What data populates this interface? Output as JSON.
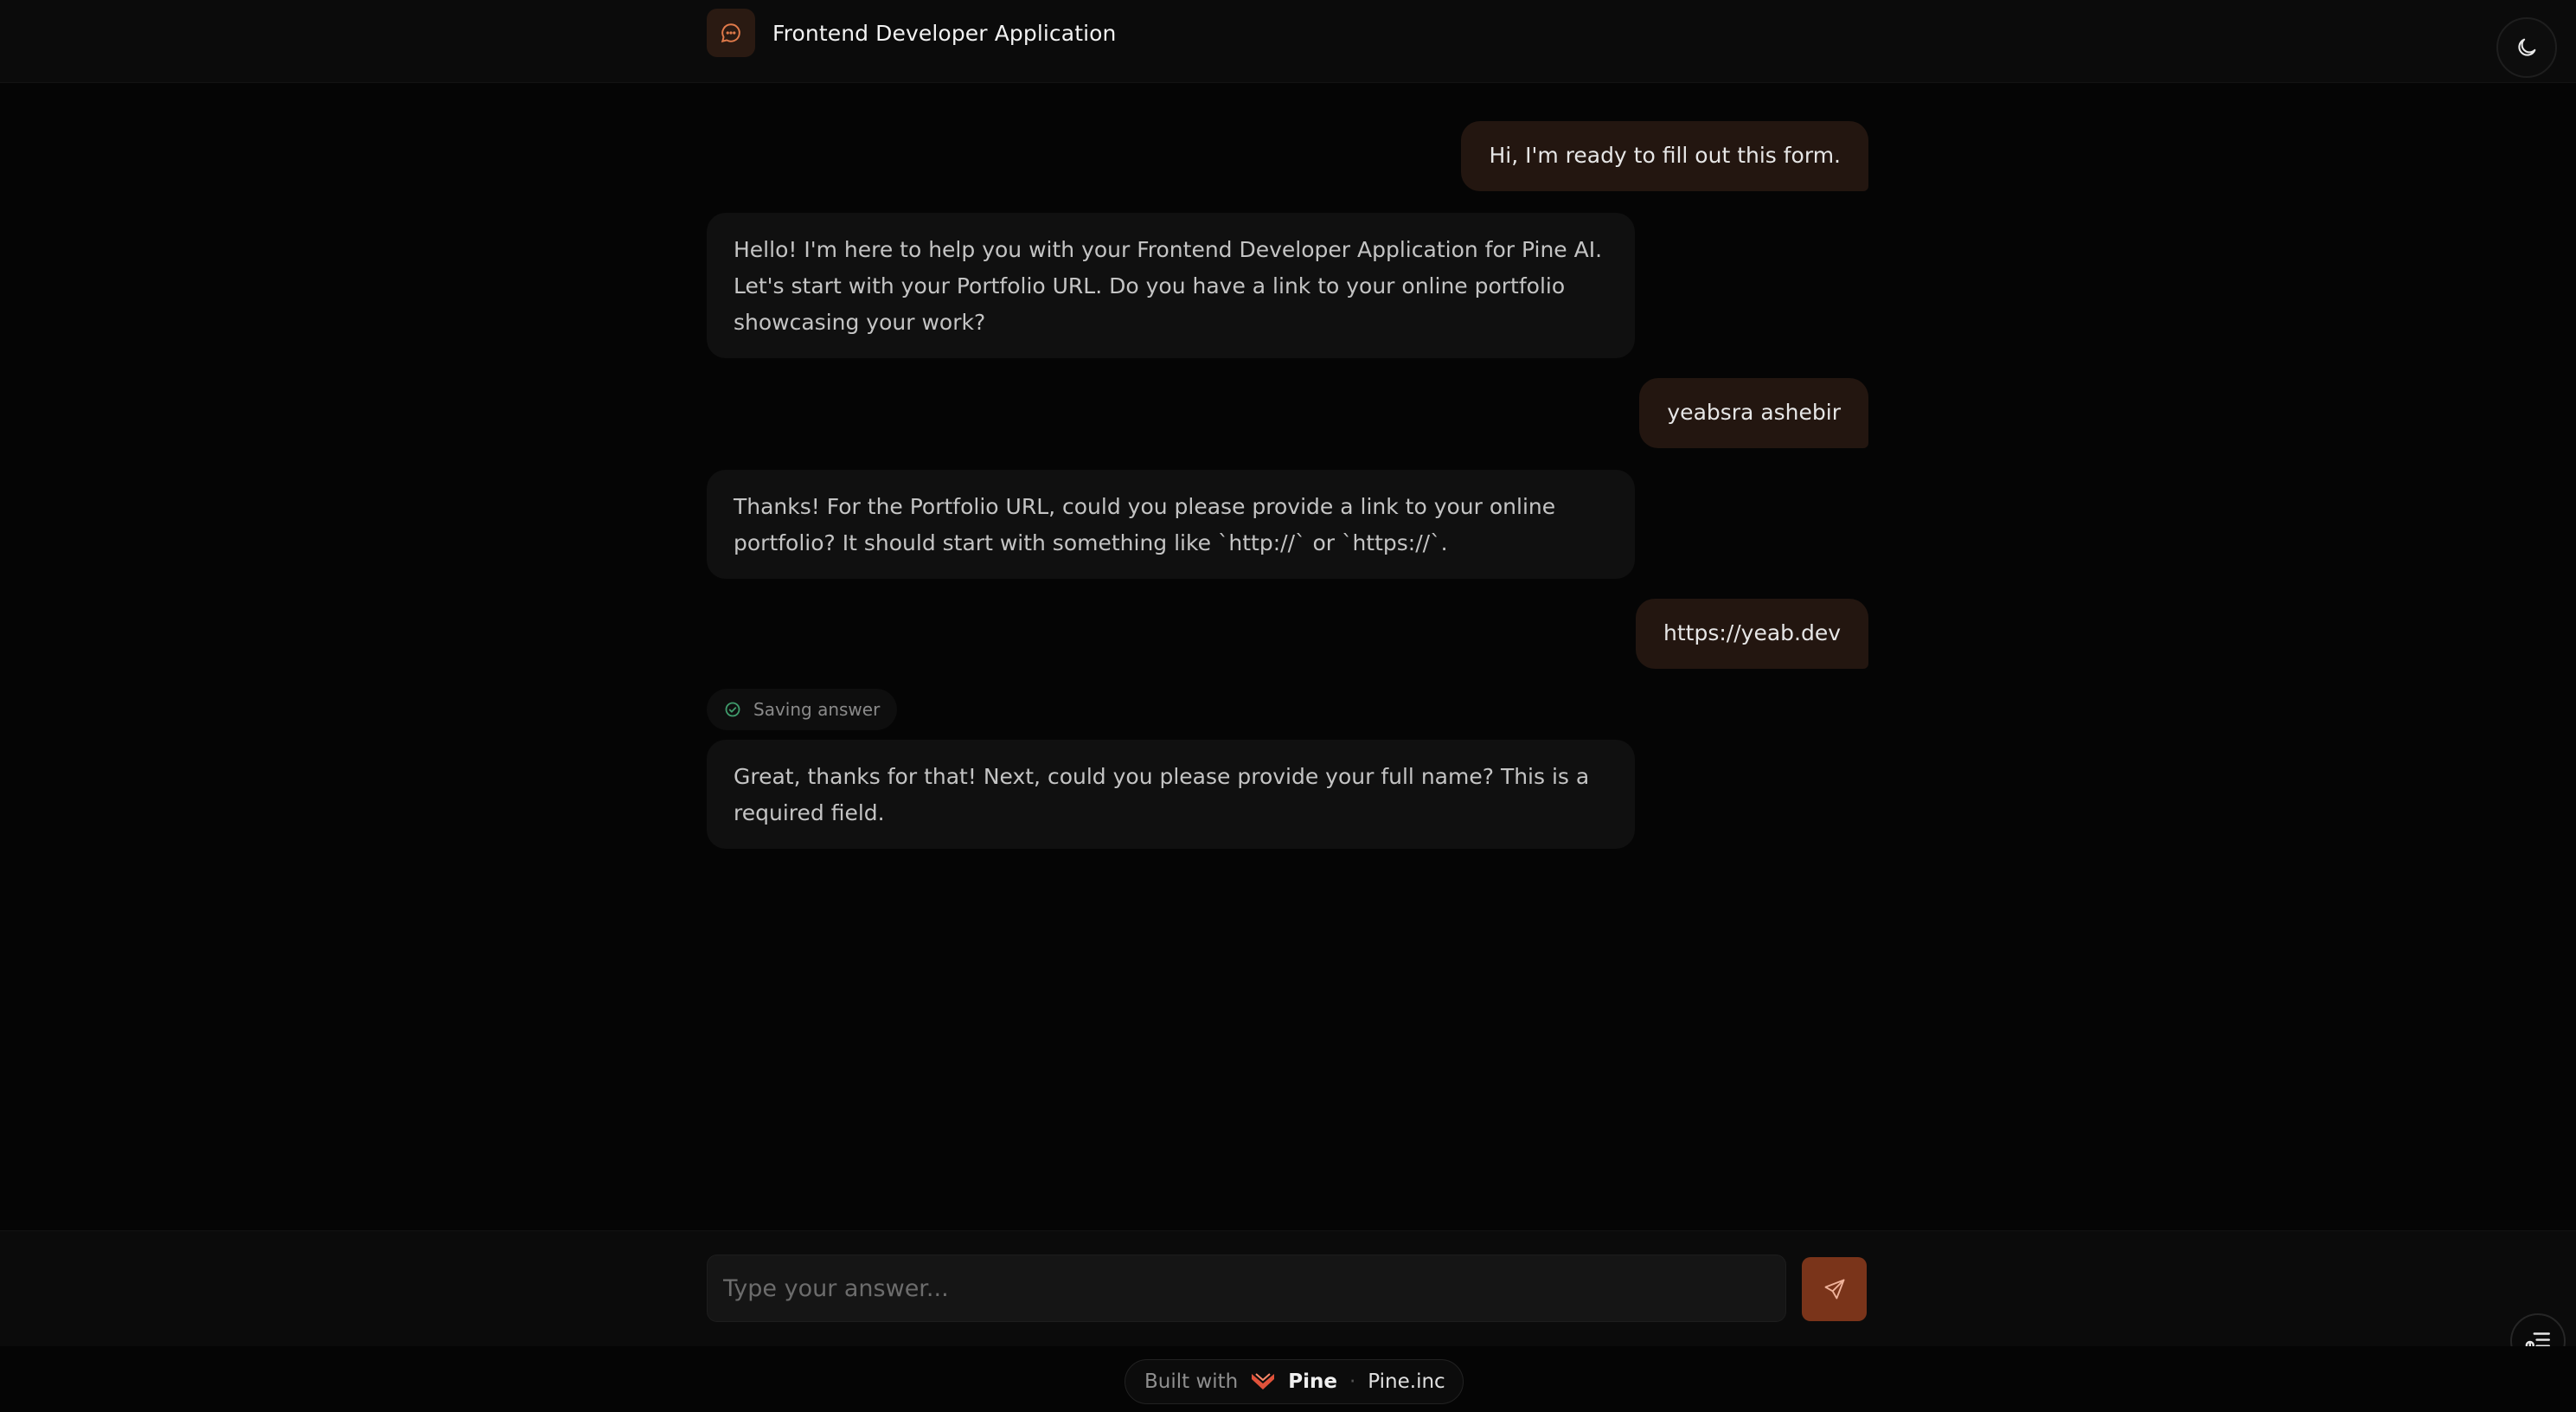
{
  "header": {
    "title": "Frontend Developer Application",
    "app_icon": "chat-bubble-icon",
    "theme_icon": "moon-icon"
  },
  "messages": [
    {
      "role": "user",
      "text": "Hi, I'm ready to fill out this form."
    },
    {
      "role": "assistant",
      "text": "Hello! I'm here to help you with your Frontend Developer Application for Pine AI. Let's start with your Portfolio URL. Do you have a link to your online portfolio showcasing your work?"
    },
    {
      "role": "user",
      "text": "yeabsra ashebir"
    },
    {
      "role": "assistant",
      "text": "Thanks! For the Portfolio URL, could you please provide a link to your online portfolio? It should start with something like `http://` or `https://`."
    },
    {
      "role": "user",
      "text": "https://yeab.dev"
    },
    {
      "role": "assistant",
      "text": "Great, thanks for that! Next, could you please provide your full name? This is a required field."
    }
  ],
  "status": {
    "text": "Saving answer",
    "icon": "check-circle-icon"
  },
  "composer": {
    "placeholder": "Type your answer...",
    "value": "",
    "send_icon": "send-icon",
    "form_icon": "form-list-icon"
  },
  "footer": {
    "built_with": "Built with",
    "brand": "Pine",
    "separator": "·",
    "link": "Pine.inc"
  },
  "colors": {
    "background": "#050505",
    "accent": "#7a341a",
    "user_bubble": "#231610",
    "bot_bubble": "#101010",
    "brand_red": "#e0523a",
    "status_green": "#3f9a6b"
  }
}
